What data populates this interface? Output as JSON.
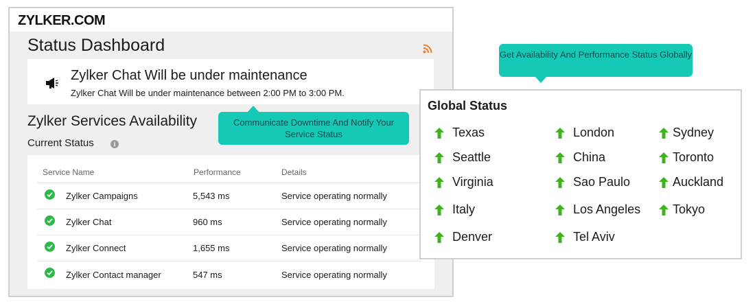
{
  "brand": {
    "logo_text": "ZYLKER.COM"
  },
  "page_title": "Status Dashboard",
  "notice": {
    "title": "Zylker Chat Will be under maintenance",
    "text": "Zylker Chat Will be under maintenance between 2:00 PM to 3:00 PM."
  },
  "availability": {
    "title": "Zylker Services Availability",
    "current_status": "Current Status",
    "headers": {
      "service": "Service Name",
      "performance": "Performance",
      "details": "Details"
    },
    "rows": [
      {
        "name": "Zylker Campaigns",
        "performance": "5,543 ms",
        "details": "Service operating normally"
      },
      {
        "name": "Zylker Chat",
        "performance": "960 ms",
        "details": "Service operating normally"
      },
      {
        "name": "Zylker Connect",
        "performance": "1,655 ms",
        "details": "Service operating normally"
      },
      {
        "name": "Zylker Contact manager",
        "performance": "547 ms",
        "details": "Service operating normally"
      }
    ]
  },
  "callouts": {
    "downtime": "Communicate Downtime And Notify Your Service Status",
    "global": "Get Availability And Performance Status Globally"
  },
  "global_status": {
    "title": "Global Status",
    "cities": [
      "Texas",
      "London",
      "Sydney",
      "Seattle",
      "China",
      "Toronto",
      "Virginia",
      "Sao Paulo",
      "Auckland",
      "Italy",
      "Los Angeles",
      "Tokyo",
      "Denver",
      "Tel Aviv"
    ]
  },
  "colors": {
    "accent": "#16c9b7",
    "status_ok": "#2fb84a",
    "rss": "#f27d23",
    "up_arrow": "#3fb21f"
  },
  "icons": {
    "notice": "megaphone-icon",
    "status": "check-icon",
    "feed": "rss-icon",
    "info": "info-icon",
    "city_status": "up-arrow-icon"
  }
}
